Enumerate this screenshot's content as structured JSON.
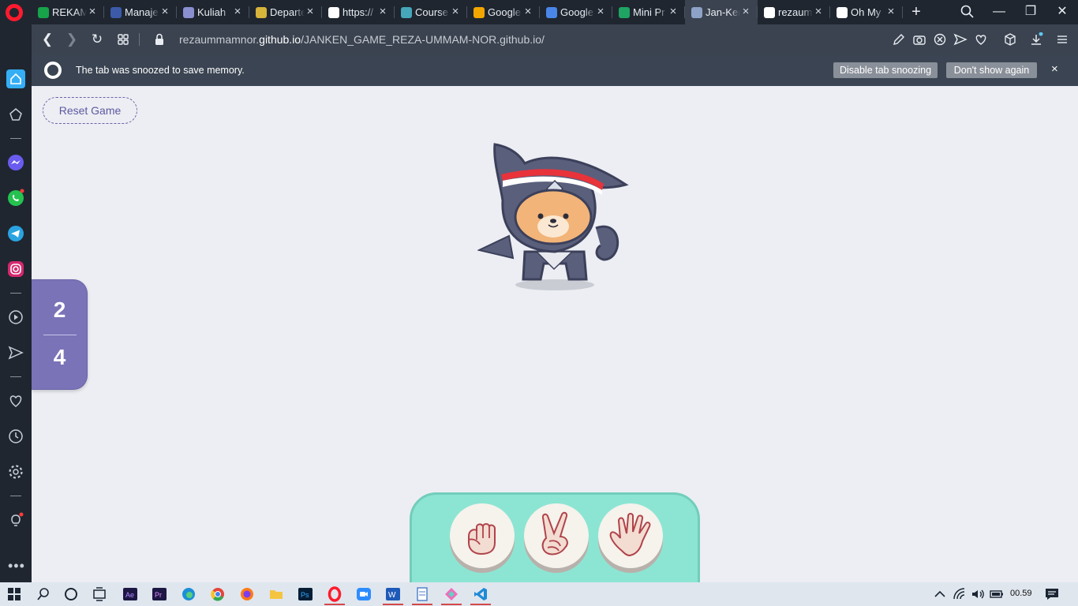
{
  "browser": {
    "tabs": [
      {
        "title": "REKAM",
        "color": "#16a34a"
      },
      {
        "title": "Manaje",
        "color": "#3c5aa8"
      },
      {
        "title": "Kuliah",
        "color": "#8a8fd0"
      },
      {
        "title": "Departe",
        "color": "#d7b43a"
      },
      {
        "title": "https://",
        "color": "#ffffff"
      },
      {
        "title": "Course",
        "color": "#45a7b9"
      },
      {
        "title": "Google",
        "color": "#f2a600"
      },
      {
        "title": "Google",
        "color": "#4a86e8"
      },
      {
        "title": "Mini Pr",
        "color": "#1fa463"
      },
      {
        "title": "Jan-Ker",
        "color": "#8ea2c8"
      },
      {
        "title": "rezaum",
        "color": "#ffffff"
      },
      {
        "title": "Oh My",
        "color": "#ffffff"
      }
    ],
    "active_tab": 9,
    "url_prefix": "rezaummamnor.",
    "url_domain": "github.io",
    "url_path": "/JANKEN_GAME_REZA-UMMAM-NOR.github.io/",
    "new_tab": "+",
    "close_symbol": "×"
  },
  "snooze": {
    "message": "The tab was snoozed to save memory.",
    "disable_label": "Disable tab snoozing",
    "dismiss_label": "Don't show again"
  },
  "game": {
    "reset_label": "Reset Game",
    "score_top": "2",
    "score_bottom": "4",
    "choices": [
      "rock",
      "scissors",
      "paper"
    ]
  },
  "taskbar": {
    "time": "00.59"
  },
  "colors": {
    "accent": "#7a73b8",
    "panel": "#8ce5d3",
    "page_bg": "#eceef3"
  }
}
